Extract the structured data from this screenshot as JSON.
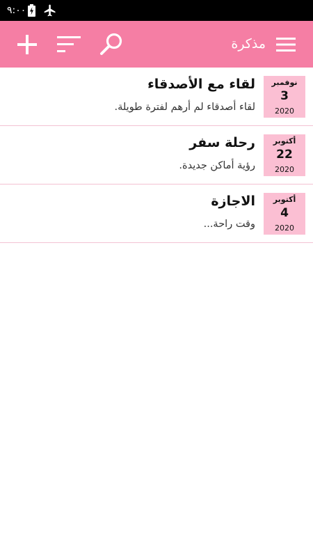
{
  "status_bar": {
    "time": "٩:٠٠"
  },
  "app_bar": {
    "title": "مذكرة",
    "color": "#f57ea4",
    "icons": [
      "add-icon",
      "sort-icon",
      "search-icon",
      "menu-icon"
    ]
  },
  "notes": [
    {
      "month": "نوفمبر",
      "day": "3",
      "year": "2020",
      "title": "لقاء مع الأصدقاء",
      "body": "لقاء أصدقاء لم أرهم لفترة طويلة."
    },
    {
      "month": "أكتوبر",
      "day": "22",
      "year": "2020",
      "title": "رحلة سفر",
      "body": "رؤية أماكن جديدة."
    },
    {
      "month": "أكتوبر",
      "day": "4",
      "year": "2020",
      "title": "الاجازة",
      "body": "وقت راحة..."
    }
  ],
  "colors": {
    "date_box": "#fbbfd3",
    "divider": "#f3c2d3"
  }
}
